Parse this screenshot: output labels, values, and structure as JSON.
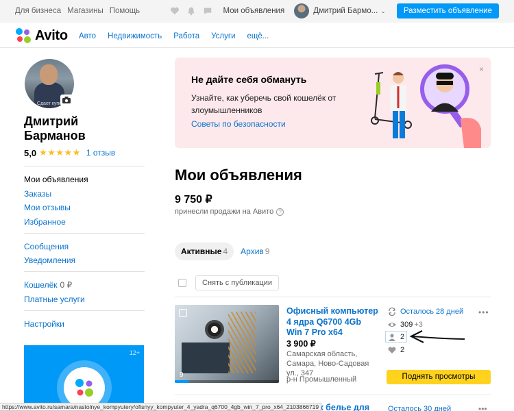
{
  "topbar": {
    "links": [
      "Для бизнеса",
      "Магазины",
      "Помощь"
    ],
    "icons": [
      "heart-icon",
      "bell-icon",
      "chat-icon"
    ],
    "my_ads": "Мои объявления",
    "user_name": "Дмитрий Бармо...",
    "post_button": "Разместить объявление",
    "accent": "#0099f7"
  },
  "nav": {
    "logo": "Avito",
    "links": [
      "Авто",
      "Недвижимость",
      "Работа",
      "Услуги",
      "ещё..."
    ]
  },
  "profile": {
    "photo_caption": "Сдает купе",
    "name_line1": "Дмитрий",
    "name_line2": "Барманов",
    "rating": "5,0",
    "stars": "★★★★★",
    "reviews": "1 отзыв"
  },
  "sidebar": {
    "group1": [
      "Мои объявления",
      "Заказы",
      "Мои отзывы",
      "Избранное"
    ],
    "group2": [
      "Сообщения",
      "Уведомления"
    ],
    "wallet_label": "Кошелёк",
    "wallet_value": "0 ₽",
    "paid_services": "Платные услуги",
    "settings": "Настройки",
    "promo_age": "12+"
  },
  "banner": {
    "title": "Не дайте себя обмануть",
    "text": "Узнайте, как уберечь свой кошелёк от злоумышленников",
    "link": "Советы по безопасности",
    "close": "×",
    "bg": "#fde8eb"
  },
  "main": {
    "title": "Мои объявления",
    "sum": "9 750 ₽",
    "sum_caption": "принесли продажи на Авито",
    "help": "?"
  },
  "tabs": [
    {
      "label": "Активные",
      "count": "4"
    },
    {
      "label": "Архив",
      "count": "9"
    }
  ],
  "actions": {
    "unpublish": "Снять с публикации"
  },
  "listing": {
    "title": "Офисный компьютер 4 ядра Q6700 4Gb Win 7 Pro x64",
    "price": "3 900 ₽",
    "address": "Самарская область, Самара, Ново-Садовая ул., 347",
    "district": "р-н Промышленный",
    "photo_count": "9",
    "days_left": "Осталось 28 дней",
    "views": "309",
    "views_today": "+3",
    "contacts": "2",
    "favorites": "2",
    "raise_button": "Поднять просмотры",
    "menu": "•••"
  },
  "next_listing": {
    "title": "Джоевик белье для",
    "stat": "Осталось 30 дней",
    "menu": "•••"
  },
  "status_url": "https://www.avito.ru/samara/nastolnye_kompyutery/ofisnyy_kompyuter_4_yadra_q6700_4gb_win_7_pro_x64_2103866719"
}
